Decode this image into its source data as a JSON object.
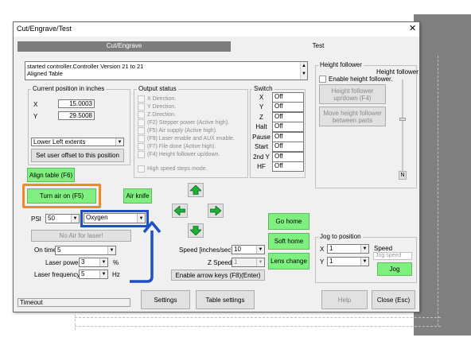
{
  "window": {
    "title": "Cut/Engrave/Test",
    "close_glyph": "✕"
  },
  "tabs": [
    {
      "label": "Cut/Engrave"
    },
    {
      "label": "Test"
    }
  ],
  "log": {
    "lines": [
      "started controller.Controller Version 21 to 21",
      "Aligned Table"
    ]
  },
  "position": {
    "legend": "Current position in inches",
    "x_label": "X",
    "x_value": "15.0003",
    "y_label": "Y",
    "y_value": "29.5008",
    "extents_value": "Lower Left extents",
    "set_offset_label": "Set user offset to this position"
  },
  "output_status": {
    "legend": "Output status",
    "items": [
      "X Direction.",
      "Y Direction.",
      "Z Direction.",
      "(F2) Stepper power (Active high).",
      "(F5) Air supply (Active high).",
      "(F9) Laser enable and AUX enable.",
      "(F7) File done (Active high).",
      "(F4) Height follower up/down."
    ],
    "high_speed_label": "High speed steps mode."
  },
  "switch": {
    "legend": "Switch",
    "rows": [
      {
        "label": "X",
        "value": "Off"
      },
      {
        "label": "Y",
        "value": "Off"
      },
      {
        "label": "Z",
        "value": "Off"
      },
      {
        "label": "Halt",
        "value": "Off"
      },
      {
        "label": "Pause",
        "value": "Off"
      },
      {
        "label": "Start",
        "value": "Off"
      },
      {
        "label": "2nd Y",
        "value": "Off"
      },
      {
        "label": "HF",
        "value": "Off"
      }
    ]
  },
  "height_follower": {
    "legend": "Height follower",
    "slider_label": "Height follower",
    "enable_label": "Enable height follower.",
    "up_down_label": "Height follower up/down (F4)",
    "move_label": "Move height follower between parts",
    "slider_button": "N"
  },
  "controls": {
    "align_table": "Align table (F6)",
    "turn_air": "Turn air on (F5)",
    "air_knife": "Air knife",
    "psi_label": "PSI",
    "psi_value": "50",
    "gas_value": "Oxygen",
    "no_air": "No Air for laser!",
    "on_time_label": "On time",
    "on_time_value": "5",
    "laser_power_label": "Laser power",
    "laser_power_value": "3",
    "laser_power_unit": "%",
    "laser_freq_label": "Laser frequency",
    "laser_freq_value": "5",
    "laser_freq_unit": "Hz"
  },
  "motion": {
    "speed_label": "Speed [inches/sec]",
    "speed_value": "10",
    "z_speed_label": "Z Speed",
    "z_speed_value": "1",
    "enable_arrow_keys": "Enable arrow keys (F8)(Enter)",
    "go_home": "Go home",
    "soft_home": "Soft home",
    "lens_change": "Lens change"
  },
  "jog": {
    "legend": "Jog to position",
    "x_label": "X",
    "x_value": "1",
    "y_label": "Y",
    "y_value": "1",
    "speed_label": "Speed",
    "jog_speed_placeholder": "Jog speed",
    "jog_button": "Jog"
  },
  "bottom": {
    "status": "Timeout",
    "settings": "Settings",
    "table_settings": "Table settings",
    "help": "Help",
    "close": "Close (Esc)"
  },
  "annotations": {
    "orange": "#f08a24",
    "blue": "#1f4fc4"
  },
  "colors": {
    "green_button": "#7ff07f",
    "tab_active": "#7d7d7d",
    "arrow_green": "#1fae3a"
  },
  "icons": [
    "arrow-up-icon",
    "arrow-down-icon",
    "arrow-left-icon",
    "arrow-right-icon",
    "close-icon",
    "chevron-down-icon"
  ]
}
